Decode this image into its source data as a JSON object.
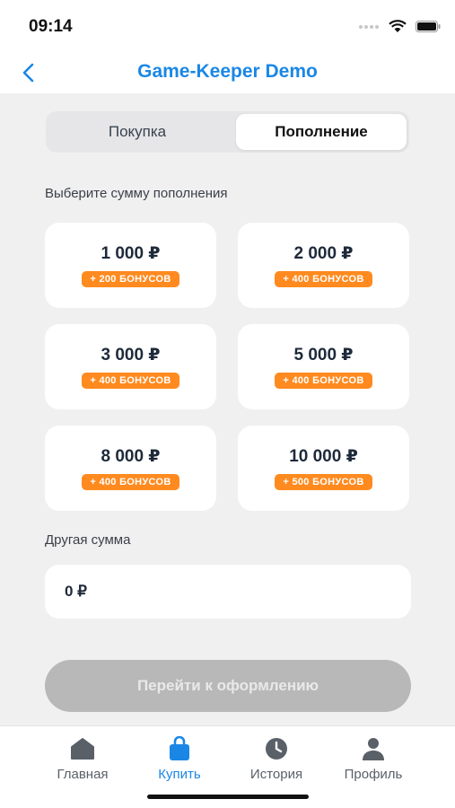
{
  "status": {
    "time": "09:14"
  },
  "header": {
    "title": "Game-Keeper Demo"
  },
  "segments": {
    "left": "Покупка",
    "right": "Пополнение"
  },
  "labels": {
    "choose_amount": "Выберите сумму пополнения",
    "other_amount": "Другая сумма"
  },
  "amounts": [
    {
      "value": "1 000 ₽",
      "bonus": "+ 200 БОНУСОВ"
    },
    {
      "value": "2 000 ₽",
      "bonus": "+ 400 БОНУСОВ"
    },
    {
      "value": "3 000 ₽",
      "bonus": "+ 400 БОНУСОВ"
    },
    {
      "value": "5 000 ₽",
      "bonus": "+ 400 БОНУСОВ"
    },
    {
      "value": "8 000 ₽",
      "bonus": "+ 400 БОНУСОВ"
    },
    {
      "value": "10 000 ₽",
      "bonus": "+ 500 БОНУСОВ"
    }
  ],
  "custom_amount": {
    "value": "0 ₽"
  },
  "cta": {
    "label": "Перейти к оформлению"
  },
  "tabs": [
    {
      "label": "Главная",
      "icon": "home-icon"
    },
    {
      "label": "Купить",
      "icon": "shopping-bag-icon"
    },
    {
      "label": "История",
      "icon": "clock-icon"
    },
    {
      "label": "Профиль",
      "icon": "person-icon"
    }
  ],
  "colors": {
    "accent": "#1a87e6",
    "bonus": "#ff8a1f",
    "disabled": "#b8b8b8"
  }
}
